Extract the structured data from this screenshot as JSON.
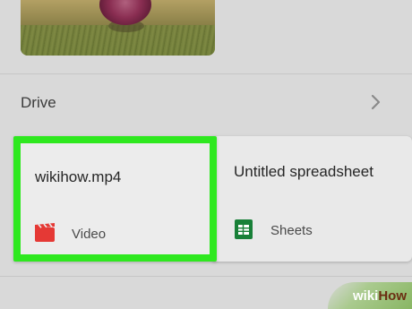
{
  "drive": {
    "label": "Drive"
  },
  "files": [
    {
      "title": "wikihow.mp4",
      "type_label": "Video",
      "icon": "video-icon",
      "selected": true,
      "icon_color": "#e53935"
    },
    {
      "title": "Untitled spreadsheet",
      "type_label": "Sheets",
      "icon": "sheets-icon",
      "selected": false,
      "icon_color": "#188038"
    }
  ],
  "colors": {
    "highlight": "#2ee81f",
    "background": "#d9d9d9",
    "card": "#e9e9e9"
  },
  "watermark": {
    "part1": "wiki",
    "part2": "How"
  }
}
